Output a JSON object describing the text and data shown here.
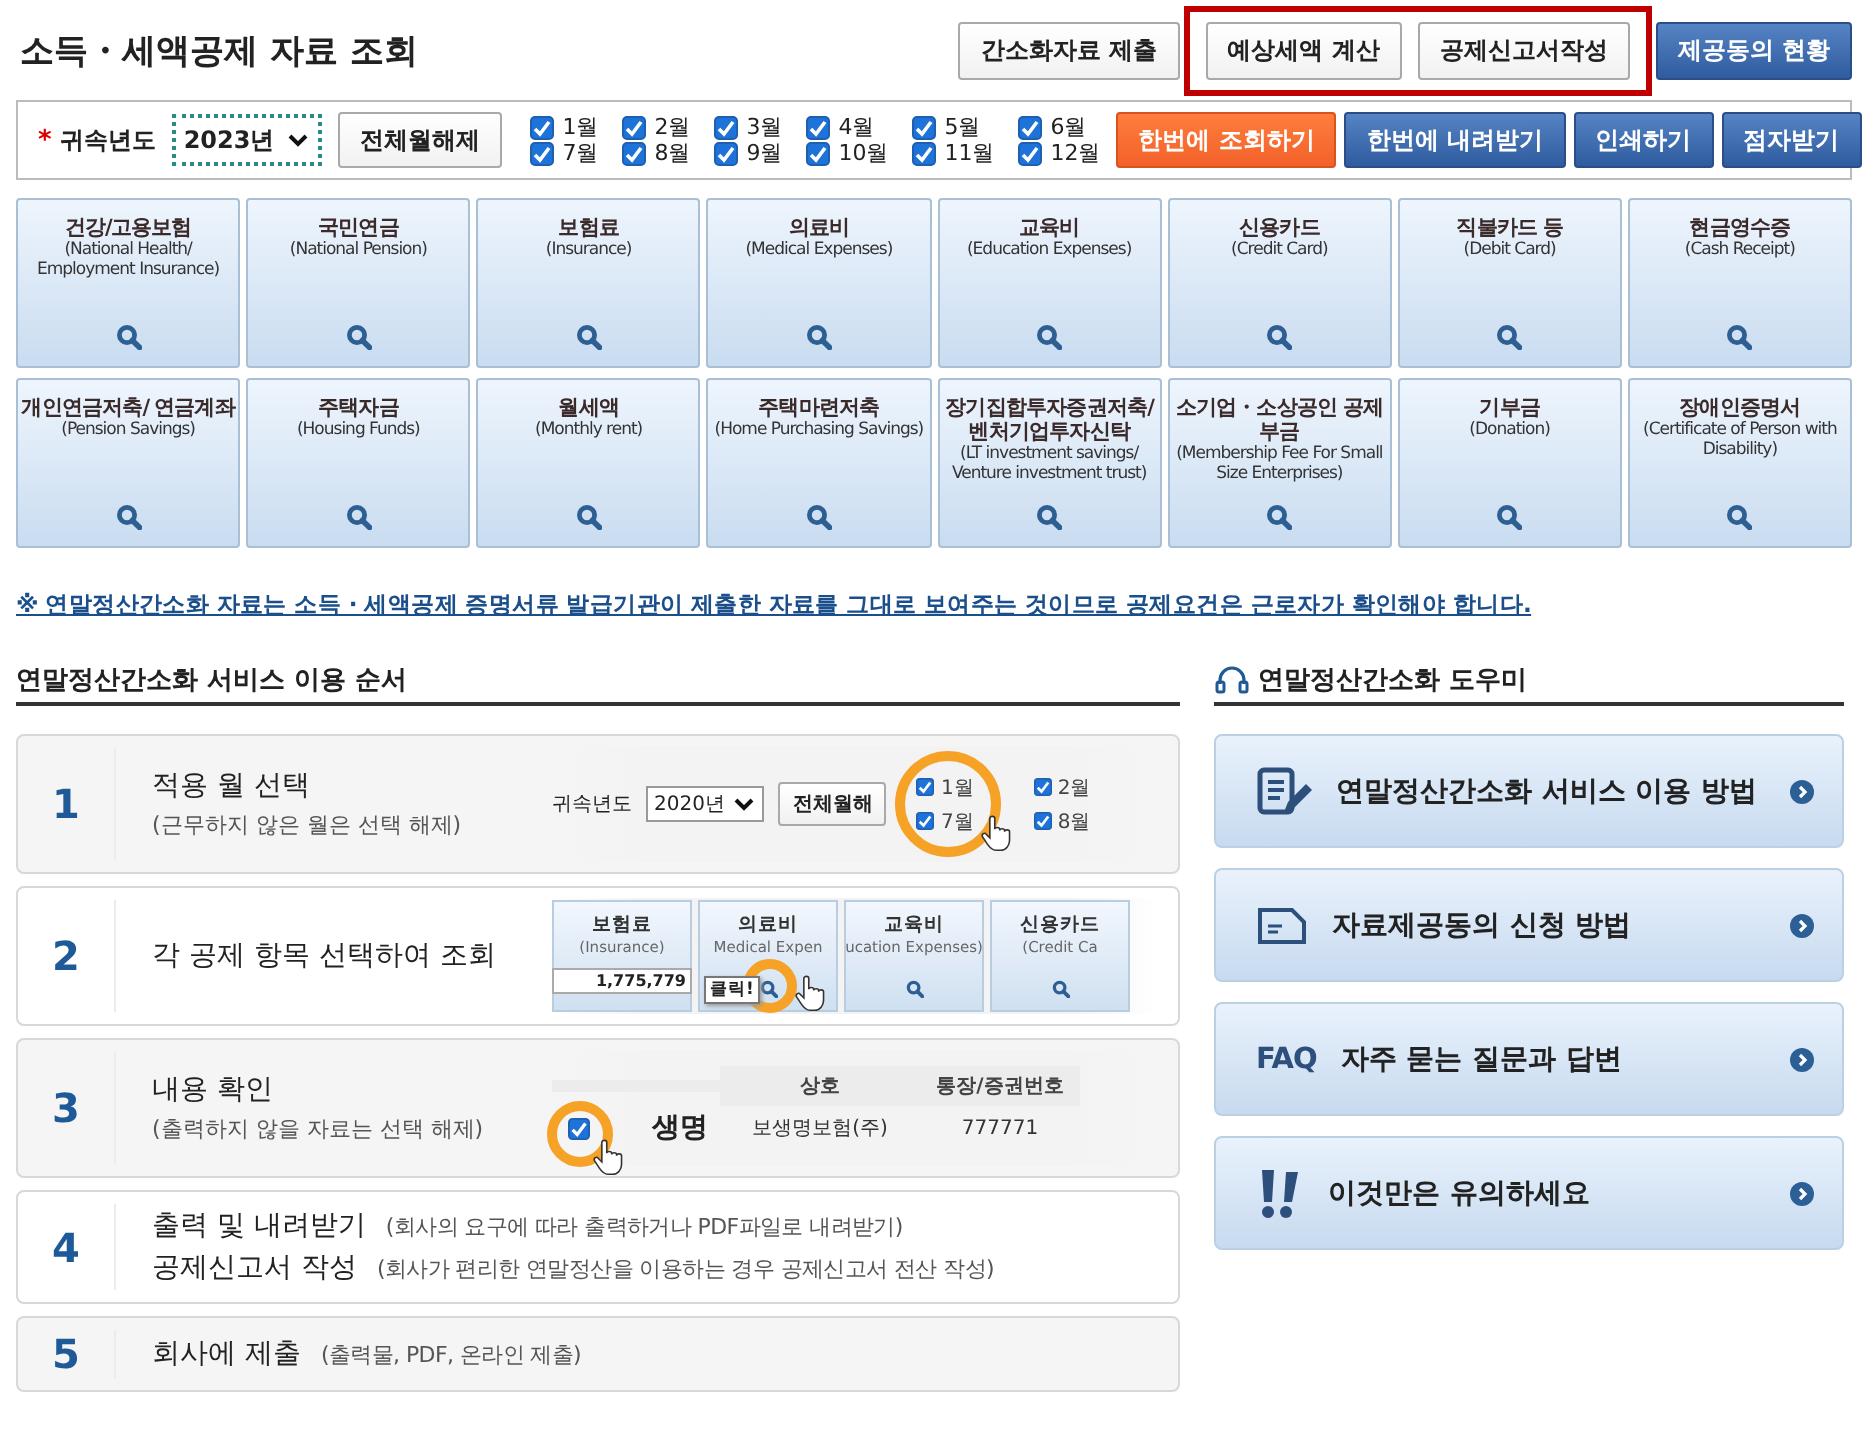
{
  "title": "소득・세액공제 자료 조회",
  "top_buttons": [
    {
      "label": "간소화자료 제출",
      "kind": "plain",
      "highlighted": false
    },
    {
      "label": "예상세액 계산",
      "kind": "plain",
      "highlighted": true
    },
    {
      "label": "공제신고서작성",
      "kind": "plain",
      "highlighted": true
    },
    {
      "label": "제공동의 현황",
      "kind": "primary",
      "highlighted": false
    }
  ],
  "filter": {
    "required_mark": "*",
    "year_label": "귀속년도",
    "year_value": "2023년",
    "clear_button": "전체월해제",
    "months": [
      {
        "label": "1월",
        "checked": true
      },
      {
        "label": "2월",
        "checked": true
      },
      {
        "label": "3월",
        "checked": true
      },
      {
        "label": "4월",
        "checked": true
      },
      {
        "label": "5월",
        "checked": true
      },
      {
        "label": "6월",
        "checked": true
      },
      {
        "label": "7월",
        "checked": true
      },
      {
        "label": "8월",
        "checked": true
      },
      {
        "label": "9월",
        "checked": true
      },
      {
        "label": "10월",
        "checked": true
      },
      {
        "label": "11월",
        "checked": true
      },
      {
        "label": "12월",
        "checked": true
      }
    ],
    "actions": [
      {
        "label": "한번에 조회하기",
        "kind": "accent"
      },
      {
        "label": "한번에 내려받기",
        "kind": "primary"
      },
      {
        "label": "인쇄하기",
        "kind": "primary"
      },
      {
        "label": "점자받기",
        "kind": "primary"
      }
    ]
  },
  "categories": [
    {
      "title": "건강/고용보험",
      "subtitle": "(National Health/ Employment Insurance)"
    },
    {
      "title": "국민연금",
      "subtitle": "(National Pension)"
    },
    {
      "title": "보험료",
      "subtitle": "(Insurance)"
    },
    {
      "title": "의료비",
      "subtitle": "(Medical Expenses)"
    },
    {
      "title": "교육비",
      "subtitle": "(Education Expenses)"
    },
    {
      "title": "신용카드",
      "subtitle": "(Credit Card)"
    },
    {
      "title": "직불카드 등",
      "subtitle": "(Debit Card)"
    },
    {
      "title": "현금영수증",
      "subtitle": "(Cash Receipt)"
    },
    {
      "title": "개인연금저축/ 연금계좌",
      "subtitle": "(Pension Savings)"
    },
    {
      "title": "주택자금",
      "subtitle": "(Housing Funds)"
    },
    {
      "title": "월세액",
      "subtitle": "(Monthly rent)"
    },
    {
      "title": "주택마련저축",
      "subtitle": "(Home Purchasing Savings)"
    },
    {
      "title": "장기집합투자증권저축/ 벤처기업투자신탁",
      "subtitle": "(LT investment savings/ Venture investment trust)"
    },
    {
      "title": "소기업・소상공인 공제부금",
      "subtitle": "(Membership Fee For Small Size Enterprises)"
    },
    {
      "title": "기부금",
      "subtitle": "(Donation)"
    },
    {
      "title": "장애인증명서",
      "subtitle": "(Certificate of Person with Disability)"
    }
  ],
  "notice": "※ 연말정산간소화 자료는 소득 · 세액공제 증명서류 발급기관이 제출한 자료를 그대로 보여주는 것이므로 공제요건은 근로자가 확인해야 합니다.",
  "steps_section": {
    "title": "연말정산간소화 서비스 이용 순서",
    "steps": [
      {
        "number": "1",
        "kind": "stacked",
        "lines": [
          {
            "title": "적용 월 선택",
            "note": "(근무하지 않은 월은 선택 해제)"
          }
        ],
        "illustration": {
          "kind": "months",
          "year_label": "귀속년도",
          "year_value": "2020년",
          "button": "전체월해",
          "months": [
            {
              "label": "1월",
              "checked": true
            },
            {
              "label": "7월",
              "checked": true
            },
            {
              "label": "2월",
              "checked": true
            },
            {
              "label": "8월",
              "checked": true
            }
          ]
        }
      },
      {
        "number": "2",
        "kind": "stacked",
        "lines": [
          {
            "title": "각 공제 항목 선택하여 조회"
          }
        ],
        "illustration": {
          "kind": "tiles",
          "callout": "클릭!",
          "tiles": [
            {
              "title": "보험료",
              "subtitle": "(Insurance)",
              "amount": "1,775,779",
              "selected": false
            },
            {
              "title": "의료비",
              "subtitle": "Medical Expen",
              "selected": true
            },
            {
              "title": "교육비",
              "subtitle": "ucation Expenses)",
              "selected": false
            },
            {
              "title": "신용카드",
              "subtitle": "(Credit Ca",
              "selected": false
            }
          ]
        }
      },
      {
        "number": "3",
        "kind": "stacked",
        "lines": [
          {
            "title": "내용 확인",
            "note": "(출력하지 않을 자료는 선택 해제)"
          }
        ],
        "illustration": {
          "kind": "table",
          "headers": [
            "상호",
            "통장/증권번호"
          ],
          "magnified_text": "생명",
          "rows": [
            {
              "checked": true,
              "cells": [
                "보생명보험(주)",
                "777771"
              ]
            }
          ]
        }
      },
      {
        "number": "4",
        "kind": "inline",
        "lines": [
          {
            "title": "출력 및 내려받기",
            "note": "(회사의 요구에 따라 출력하거나 PDF파일로 내려받기)"
          },
          {
            "title": "공제신고서 작성",
            "note": "(회사가 편리한 연말정산을 이용하는 경우 공제신고서 전산 작성)"
          }
        ]
      },
      {
        "number": "5",
        "kind": "inline",
        "lines": [
          {
            "title": "회사에 제출",
            "note": "(출력물, PDF, 온라인 제출)"
          }
        ]
      }
    ]
  },
  "helper": {
    "title": "연말정산간소화 도우미",
    "items": [
      {
        "label": "연말정산간소화 서비스 이용 방법",
        "kind": "guide"
      },
      {
        "label": "자료제공동의 신청 방법",
        "kind": "document"
      },
      {
        "label": "자주 묻는 질문과 답변",
        "kind": "faq",
        "tag": "FAQ"
      },
      {
        "label": "이것만은 유의하세요",
        "kind": "alert"
      }
    ]
  }
}
